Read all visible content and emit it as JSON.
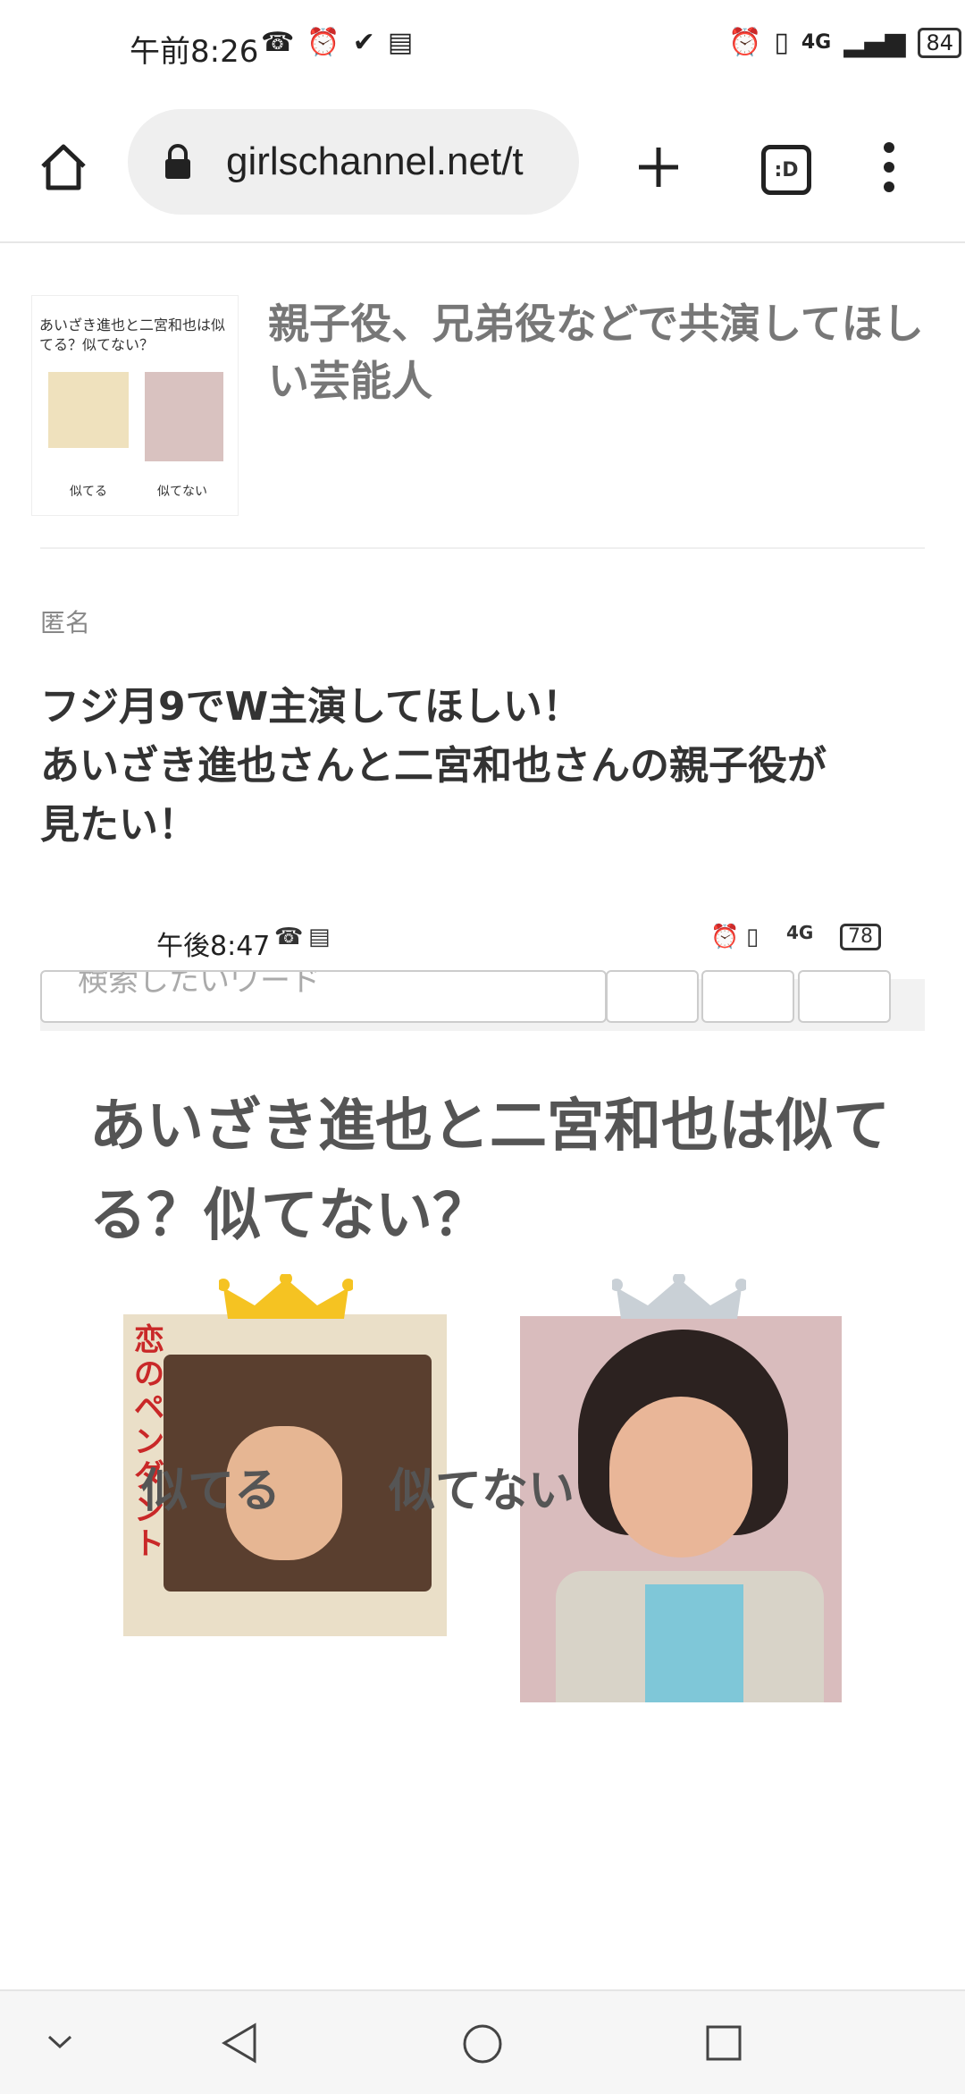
{
  "status_bar": {
    "time": "午前8:26",
    "network": "4G",
    "battery": "84"
  },
  "browser": {
    "url": "girlschannel.net/t",
    "tabs_label": ":D"
  },
  "related": {
    "thumbnail_question": "あいざき進也と二宮和也は似てる？似てない？",
    "thumbnail_option1": "似てる",
    "thumbnail_option2": "似てない",
    "title": "親子役、兄弟役などで共演してほしい芸能人"
  },
  "comment": {
    "author": "匿名",
    "line1": "フジ月9でW主演してほしい！",
    "line2": "あいざき進也さんと二宮和也さんの親子役が",
    "line3": "見たい！"
  },
  "embedded_screenshot": {
    "status_time": "午後8:47",
    "network": "4G",
    "battery": "78",
    "search_placeholder": "検索したいワード",
    "heading": "あいざき進也と二宮和也は似てる？似てない？",
    "record_title": "恋のペンダント",
    "option1": "似てる",
    "option2": "似てない"
  },
  "colors": {
    "crown_gold": "#f5c322",
    "crown_silver": "#c9d0d6"
  }
}
